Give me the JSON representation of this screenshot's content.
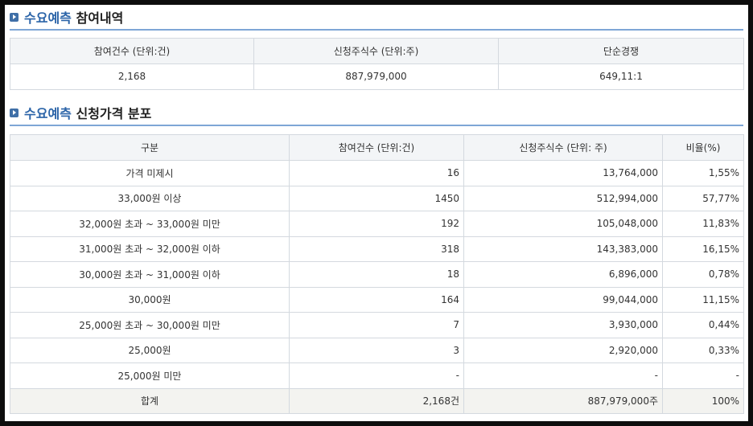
{
  "section1": {
    "title_accent": "수요예측",
    "title_rest": "참여내역",
    "headers": [
      "참여건수 (단위:건)",
      "신청주식수 (단위:주)",
      "단순경쟁"
    ],
    "row": [
      "2,168",
      "887,979,000",
      "649,11:1"
    ]
  },
  "section2": {
    "title_accent": "수요예측",
    "title_rest": "신청가격 분포",
    "headers": [
      "구분",
      "참여건수 (단위:건)",
      "신청주식수 (단위: 주)",
      "비율(%)"
    ],
    "rows": [
      [
        "가격 미제시",
        "16",
        "13,764,000",
        "1,55%"
      ],
      [
        "33,000원 이상",
        "1450",
        "512,994,000",
        "57,77%"
      ],
      [
        "32,000원 초과 ~ 33,000원 미만",
        "192",
        "105,048,000",
        "11,83%"
      ],
      [
        "31,000원 초과 ~ 32,000원 이하",
        "318",
        "143,383,000",
        "16,15%"
      ],
      [
        "30,000원 초과 ~ 31,000원 이하",
        "18",
        "6,896,000",
        "0,78%"
      ],
      [
        "30,000원",
        "164",
        "99,044,000",
        "11,15%"
      ],
      [
        "25,000원 초과 ~ 30,000원 미만",
        "7",
        "3,930,000",
        "0,44%"
      ],
      [
        "25,000원",
        "3",
        "2,920,000",
        "0,33%"
      ],
      [
        "25,000원 미만",
        "-",
        "-",
        "-"
      ]
    ],
    "total": [
      "합계",
      "2,168건",
      "887,979,000주",
      "100%"
    ]
  }
}
